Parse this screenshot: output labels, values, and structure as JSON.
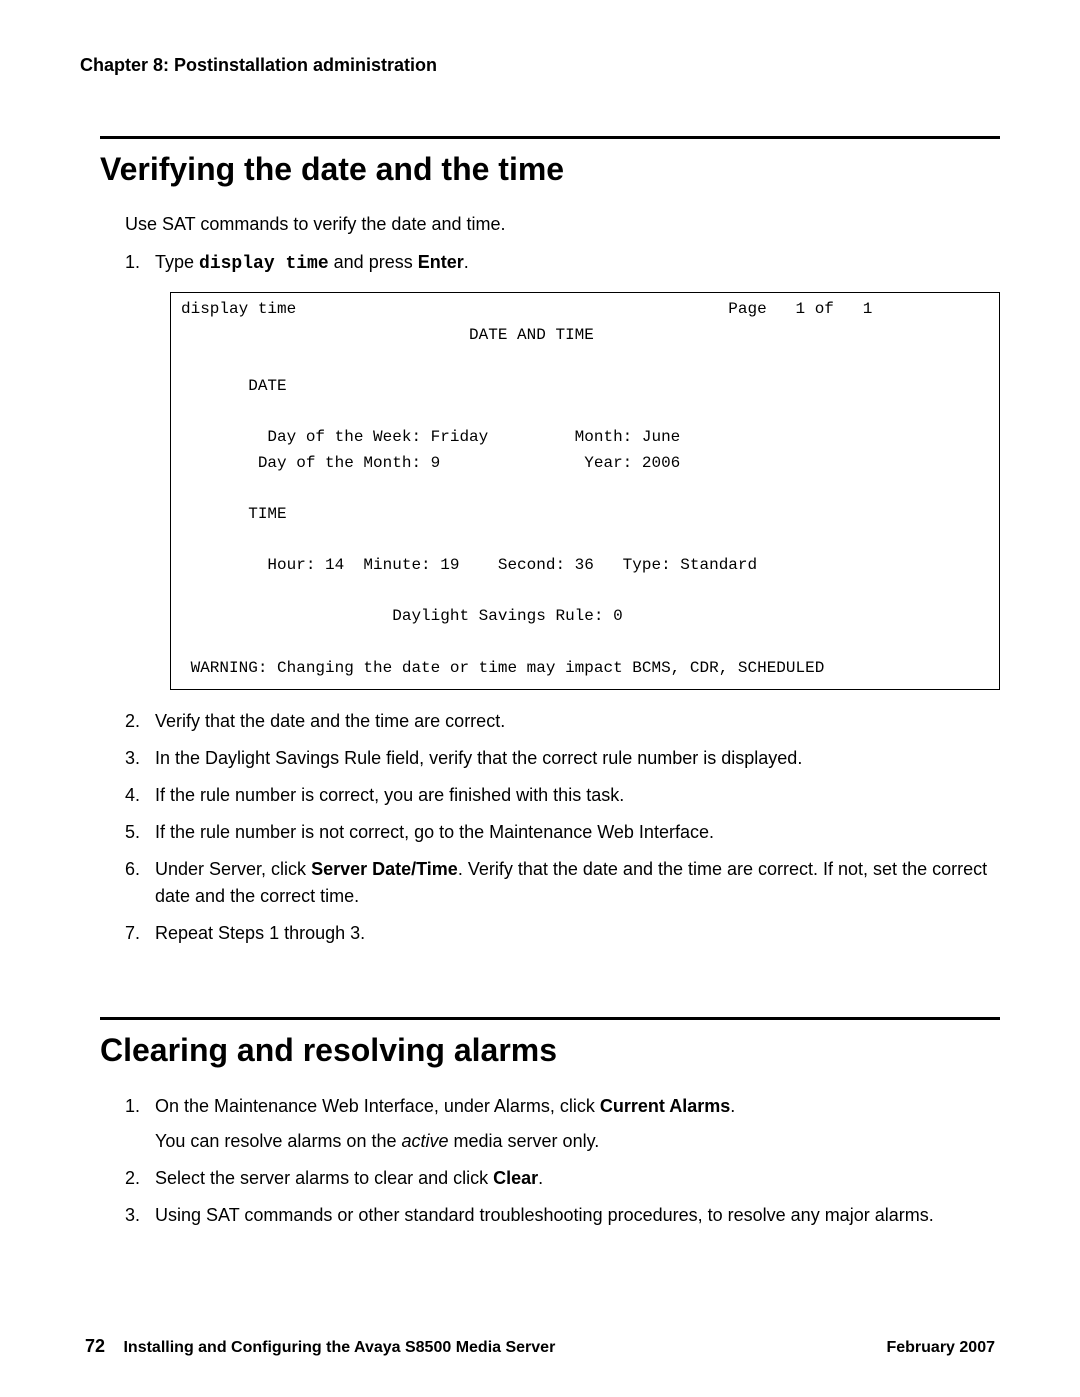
{
  "chapter_header": "Chapter 8: Postinstallation administration",
  "section1": {
    "title": "Verifying the date and the time",
    "intro": "Use SAT commands to verify the date and time.",
    "step1_num": "1.",
    "step1_a": "Type ",
    "step1_cmd": "display time",
    "step1_b": " and press ",
    "step1_enter": "Enter",
    "step1_c": ".",
    "terminal": "display time                                             Page   1 of   1\n                              DATE AND TIME\n\n       DATE\n\n         Day of the Week: Friday         Month: June\n        Day of the Month: 9               Year: 2006\n\n       TIME\n\n         Hour: 14  Minute: 19    Second: 36   Type: Standard\n\n                      Daylight Savings Rule: 0\n\n WARNING: Changing the date or time may impact BCMS, CDR, SCHEDULED",
    "steps": [
      {
        "n": "2.",
        "t": "Verify that the date and the time are correct."
      },
      {
        "n": "3.",
        "t": "In the Daylight Savings Rule field, verify that the correct rule number is displayed."
      },
      {
        "n": "4.",
        "t": "If the rule number is correct, you are finished with this task."
      },
      {
        "n": "5.",
        "t": "If the rule number is not correct, go to the Maintenance Web Interface."
      }
    ],
    "step6_n": "6.",
    "step6_a": "Under Server, click ",
    "step6_b": "Server Date/Time",
    "step6_c": ". Verify that the date and the time are correct. If not, set the correct date and the correct time.",
    "step7_n": "7.",
    "step7_t": "Repeat Steps 1 through 3."
  },
  "section2": {
    "title": "Clearing and resolving alarms",
    "step1_n": "1.",
    "step1_a": "On the Maintenance Web Interface, under Alarms, click ",
    "step1_b": "Current Alarms",
    "step1_c": ".",
    "step1_sub_a": "You can resolve alarms on the ",
    "step1_sub_b": "active",
    "step1_sub_c": " media server only.",
    "step2_n": "2.",
    "step2_a": "Select the server alarms to clear and click ",
    "step2_b": "Clear",
    "step2_c": ".",
    "step3_n": "3.",
    "step3_t": "Using SAT commands or other standard troubleshooting procedures, to resolve any major alarms."
  },
  "footer": {
    "page": "72",
    "doc": "Installing and Configuring the Avaya S8500 Media Server",
    "date": "February 2007"
  }
}
